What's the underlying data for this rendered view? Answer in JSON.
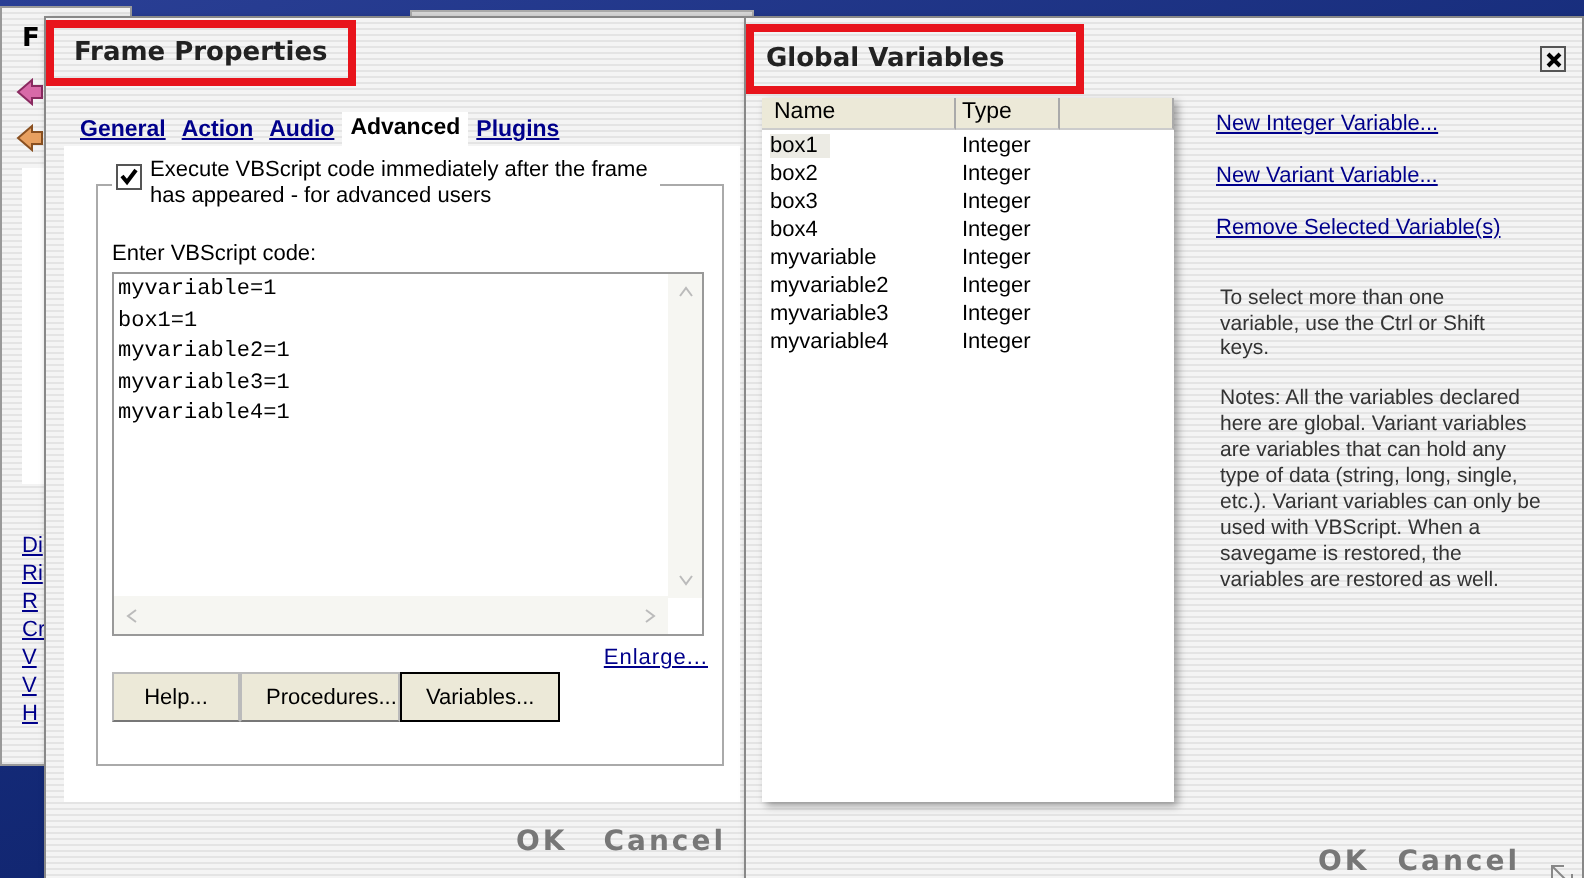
{
  "back_window": {
    "title": "F",
    "links": [
      "Di",
      "Ri",
      "R",
      "Cr",
      "V",
      "V",
      "H"
    ]
  },
  "frame_properties": {
    "title": "Frame Properties",
    "title_highlighted": true,
    "tabs": [
      {
        "label": "General",
        "selected": false
      },
      {
        "label": "Action",
        "selected": false
      },
      {
        "label": "Audio",
        "selected": false
      },
      {
        "label": "Advanced",
        "selected": true
      },
      {
        "label": "Plugins",
        "selected": false
      }
    ],
    "checkbox": {
      "label": "Execute VBScript code immediately after the frame has appeared - for advanced users",
      "checked": true
    },
    "code_label": "Enter VBScript code:",
    "code": [
      "myvariable=1",
      "box1=1",
      "myvariable2=1",
      "myvariable3=1",
      "myvariable4=1"
    ],
    "enlarge_link": "Enlarge...",
    "buttons": [
      {
        "label": "Help...",
        "focused": false
      },
      {
        "label": "Procedures...",
        "focused": false
      },
      {
        "label": "Variables...",
        "focused": true
      }
    ],
    "ok": "OK",
    "cancel": "Cancel"
  },
  "global_variables": {
    "title": "Global Variables",
    "title_highlighted": true,
    "columns": [
      "Name",
      "Type"
    ],
    "rows": [
      {
        "name": "box1",
        "type": "Integer",
        "selected": true
      },
      {
        "name": "box2",
        "type": "Integer",
        "selected": false
      },
      {
        "name": "box3",
        "type": "Integer",
        "selected": false
      },
      {
        "name": "box4",
        "type": "Integer",
        "selected": false
      },
      {
        "name": "myvariable",
        "type": "Integer",
        "selected": false
      },
      {
        "name": "myvariable2",
        "type": "Integer",
        "selected": false
      },
      {
        "name": "myvariable3",
        "type": "Integer",
        "selected": false
      },
      {
        "name": "myvariable4",
        "type": "Integer",
        "selected": false
      }
    ],
    "links": [
      "New Integer Variable...",
      "New Variant Variable...",
      "Remove Selected Variable(s)"
    ],
    "hint": "To select more than one variable, use the Ctrl or Shift keys.",
    "notes": "Notes: All the variables declared here are global. Variant variables are variables that can hold any type of data (string, long, single, etc.). Variant variables can only be used with VBScript.   When a savegame is restored, the variables are restored as well.",
    "ok": "OK",
    "cancel": "Cancel"
  }
}
